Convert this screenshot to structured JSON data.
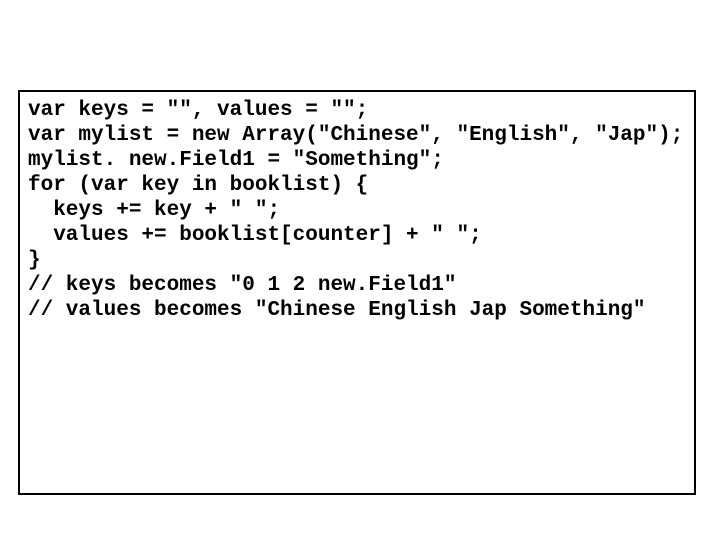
{
  "code": {
    "lines": [
      "var keys = \"\", values = \"\";",
      "var mylist = new Array(\"Chinese\", \"English\", \"Jap\");",
      "mylist. new.Field1 = \"Something\";",
      "",
      "for (var key in booklist) {",
      "  keys += key + \" \";",
      "  values += booklist[counter] + \" \";",
      "}",
      "",
      "// keys becomes \"0 1 2 new.Field1\"",
      "// values becomes \"Chinese English Jap Something\""
    ]
  }
}
